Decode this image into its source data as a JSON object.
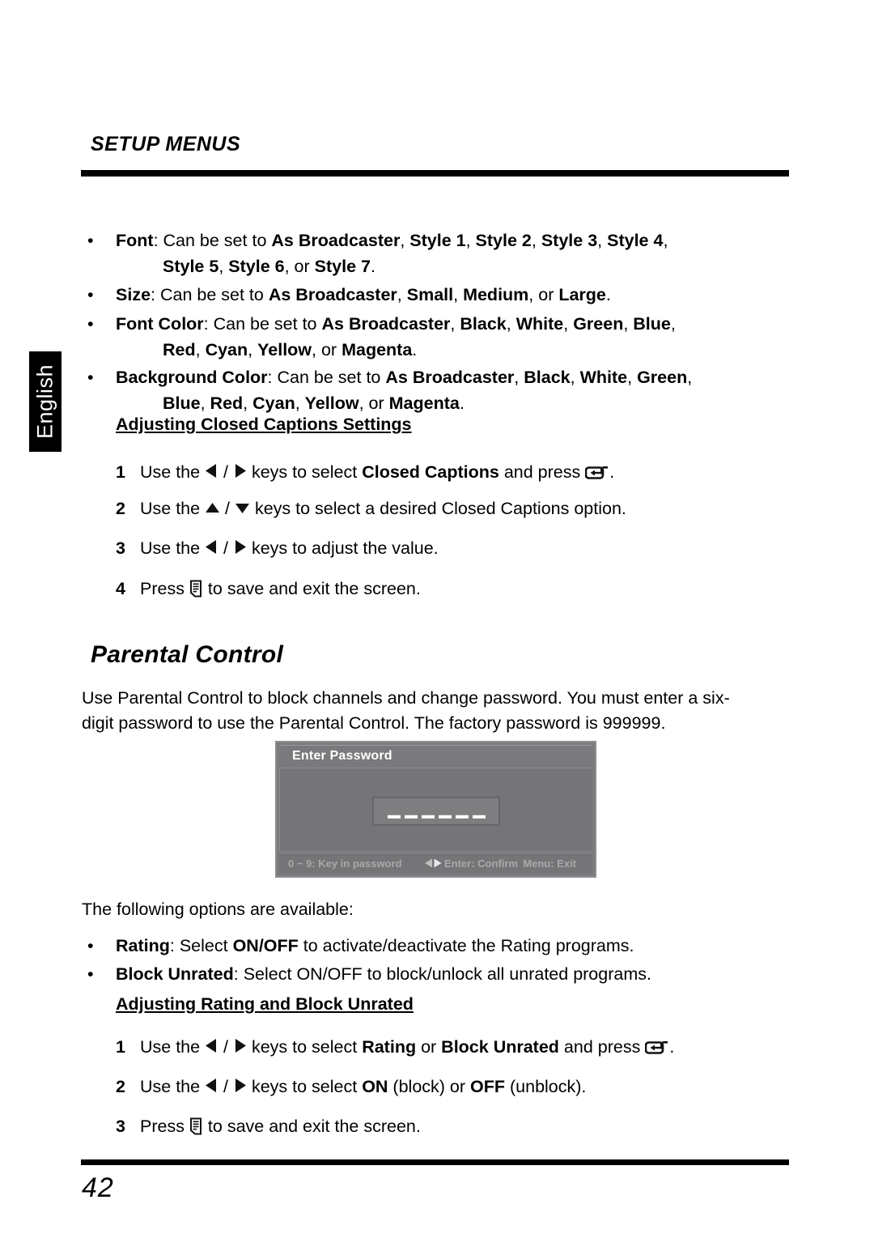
{
  "page": {
    "header_title": "SETUP MENUS",
    "language_tab": "English",
    "page_number": "42"
  },
  "bullets_top": [
    {
      "label": "Font",
      "line1_prefix": ": Can be set to ",
      "line1_values": [
        "As Broadcaster",
        "Style 1",
        "Style 2",
        "Style 3",
        "Style 4"
      ],
      "line2_values": [
        "Style 5",
        "Style 6"
      ],
      "line2_last": "Style 7",
      "line2_conj": ", or "
    },
    {
      "label": "Size",
      "line1_prefix": ": Can be set to ",
      "line1_values": [
        "As Broadcaster",
        "Small",
        "Medium"
      ],
      "line1_conj": ", or ",
      "line1_last": "Large"
    },
    {
      "label": "Font Color",
      "line1_prefix": ": Can be set to ",
      "line1_values": [
        "As Broadcaster",
        "Black",
        "White",
        "Green",
        "Blue"
      ],
      "line2_values": [
        "Red",
        "Cyan",
        "Yellow"
      ],
      "line2_conj": ", or ",
      "line2_last": "Magenta"
    },
    {
      "label": "Background Color",
      "line1_prefix": ": Can be set to ",
      "line1_values": [
        "As Broadcaster",
        "Black",
        "White",
        "Green"
      ],
      "line2_values": [
        "Blue",
        "Red",
        "Cyan",
        "Yellow"
      ],
      "line2_conj": ", or ",
      "line2_last": "Magenta"
    }
  ],
  "cc_heading": "Adjusting Closed Captions Settings",
  "cc_steps": [
    {
      "num": "1",
      "a": "Use the ",
      "keys": "left-right",
      "b": " keys to select ",
      "bold": "Closed Captions",
      "c": " and press ",
      "icon": "enter-key-icon",
      "d": "."
    },
    {
      "num": "2",
      "a": "Use the ",
      "keys": "up-down",
      "b": " keys to select a desired Closed Captions option.",
      "bold": "",
      "c": "",
      "icon": "",
      "d": ""
    },
    {
      "num": "3",
      "a": "Use the ",
      "keys": "left-right",
      "b": " keys to adjust the value.",
      "bold": "",
      "c": "",
      "icon": "",
      "d": ""
    },
    {
      "num": "4",
      "a": "Press ",
      "keys": "",
      "b": "",
      "bold": "",
      "c": "",
      "icon": "menu-key-icon",
      "d": " to save and exit the screen."
    }
  ],
  "parental": {
    "title": "Parental Control",
    "intro_line1": "Use Parental Control to block channels and change password. You must enter a six-",
    "intro_line2": "digit password to use the Parental Control. The factory password is 999999.",
    "following": "The following options are available:"
  },
  "osd": {
    "title": "Enter Password",
    "password_dash_count": 6,
    "footer_left": "0 ~ 9: Key in password",
    "footer_mid": "Enter: Confirm",
    "footer_right": "Menu: Exit",
    "colors": {
      "window_bg": "#7c7c7e",
      "body_bg": "#757578",
      "field_bg": "#7e7e81",
      "title_text": "#ffffff",
      "footer_text": "#a9a9ab"
    }
  },
  "bullets_bottom": [
    {
      "label": "Rating",
      "mid": ": Select ",
      "bold2": "ON/OFF",
      "tail": " to activate/deactivate the Rating programs."
    },
    {
      "label": "Block Unrated",
      "mid": ": Select ON/OFF to block/unlock all unrated programs.",
      "bold2": "",
      "tail": ""
    }
  ],
  "rating_heading": "Adjusting Rating and Block Unrated",
  "rating_steps": [
    {
      "num": "1",
      "a": "Use the ",
      "b": " keys to select ",
      "bold1": "Rating",
      "mid": " or ",
      "bold2": "Block Unrated",
      "c": " and press ",
      "icon": "enter-key-icon",
      "d": "."
    },
    {
      "num": "2",
      "a": "Use the ",
      "b": " keys to select ",
      "bold1": "ON",
      "mid": " (block) or ",
      "bold2": "OFF",
      "c": " (unblock).",
      "icon": "",
      "d": ""
    },
    {
      "num": "3",
      "a": "Press ",
      "b": "",
      "bold1": "",
      "mid": "",
      "bold2": "",
      "c": "",
      "icon": "menu-key-icon",
      "d": " to save and exit the screen."
    }
  ]
}
